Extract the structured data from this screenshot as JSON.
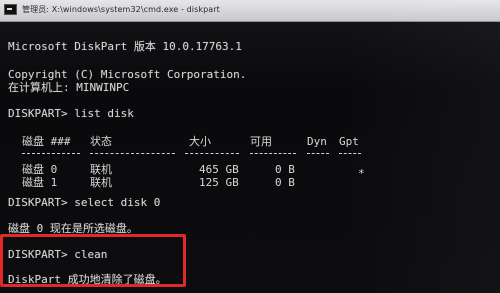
{
  "window": {
    "title": "管理员: X:\\windows\\system32\\cmd.exe - diskpart"
  },
  "console": {
    "banner": "Microsoft DiskPart 版本 10.0.17763.1",
    "copyright": "Copyright (C) Microsoft Corporation.",
    "computer_line": "在计算机上: MINWINPC",
    "cmd_list": "DISKPART> list disk",
    "columns": [
      "磁盘 ###",
      "状态",
      "大小",
      "可用",
      "Dyn",
      "Gpt"
    ],
    "disks": [
      {
        "name": "磁盘 0",
        "status": "联机",
        "size": "465 GB",
        "free": "0 B",
        "dyn": "",
        "gpt": "*"
      },
      {
        "name": "磁盘 1",
        "status": "联机",
        "size": "125 GB",
        "free": "0 B",
        "dyn": "",
        "gpt": ""
      }
    ],
    "cmd_select": "DISKPART> select disk 0",
    "select_result": "磁盘 0 现在是所选磁盘。",
    "cmd_clean": "DISKPART> clean",
    "clean_result": "DiskPart 成功地清除了磁盘。"
  },
  "colors": {
    "highlight": "#e02a2a"
  }
}
